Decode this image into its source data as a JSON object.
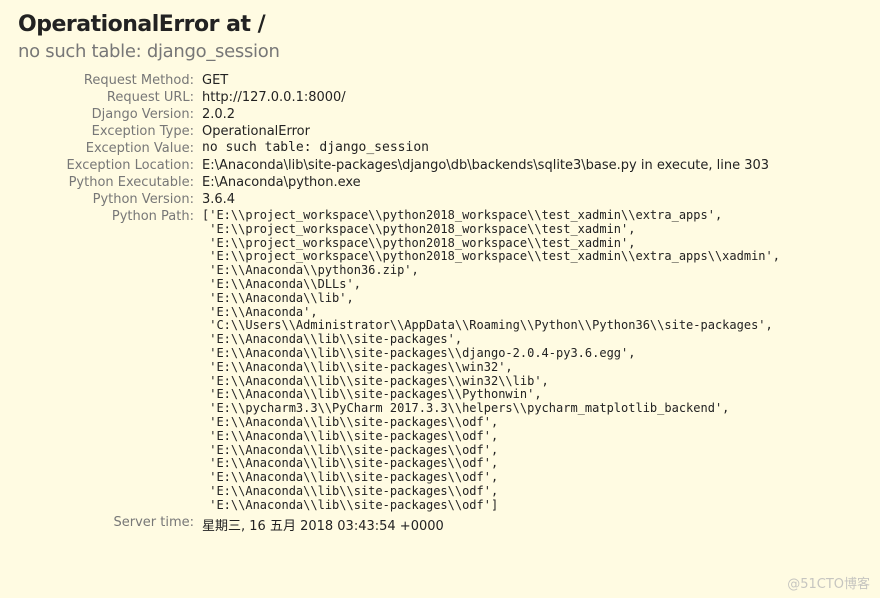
{
  "title": "OperationalError at /",
  "subtitle": "no such table: django_session",
  "labels": {
    "request_method": "Request Method:",
    "request_url": "Request URL:",
    "django_version": "Django Version:",
    "exception_type": "Exception Type:",
    "exception_value": "Exception Value:",
    "exception_location": "Exception Location:",
    "python_executable": "Python Executable:",
    "python_version": "Python Version:",
    "python_path": "Python Path:",
    "server_time": "Server time:"
  },
  "values": {
    "request_method": "GET",
    "request_url": "http://127.0.0.1:8000/",
    "django_version": "2.0.2",
    "exception_type": "OperationalError",
    "exception_value": "no such table: django_session",
    "exception_location": "E:\\Anaconda\\lib\\site-packages\\django\\db\\backends\\sqlite3\\base.py in execute, line 303",
    "python_executable": "E:\\Anaconda\\python.exe",
    "python_version": "3.6.4",
    "python_path": "['E:\\\\project_workspace\\\\python2018_workspace\\\\test_xadmin\\\\extra_apps',\n 'E:\\\\project_workspace\\\\python2018_workspace\\\\test_xadmin',\n 'E:\\\\project_workspace\\\\python2018_workspace\\\\test_xadmin',\n 'E:\\\\project_workspace\\\\python2018_workspace\\\\test_xadmin\\\\extra_apps\\\\xadmin',\n 'E:\\\\Anaconda\\\\python36.zip',\n 'E:\\\\Anaconda\\\\DLLs',\n 'E:\\\\Anaconda\\\\lib',\n 'E:\\\\Anaconda',\n 'C:\\\\Users\\\\Administrator\\\\AppData\\\\Roaming\\\\Python\\\\Python36\\\\site-packages',\n 'E:\\\\Anaconda\\\\lib\\\\site-packages',\n 'E:\\\\Anaconda\\\\lib\\\\site-packages\\\\django-2.0.4-py3.6.egg',\n 'E:\\\\Anaconda\\\\lib\\\\site-packages\\\\win32',\n 'E:\\\\Anaconda\\\\lib\\\\site-packages\\\\win32\\\\lib',\n 'E:\\\\Anaconda\\\\lib\\\\site-packages\\\\Pythonwin',\n 'E:\\\\pycharm3.3\\\\PyCharm 2017.3.3\\\\helpers\\\\pycharm_matplotlib_backend',\n 'E:\\\\Anaconda\\\\lib\\\\site-packages\\\\odf',\n 'E:\\\\Anaconda\\\\lib\\\\site-packages\\\\odf',\n 'E:\\\\Anaconda\\\\lib\\\\site-packages\\\\odf',\n 'E:\\\\Anaconda\\\\lib\\\\site-packages\\\\odf',\n 'E:\\\\Anaconda\\\\lib\\\\site-packages\\\\odf',\n 'E:\\\\Anaconda\\\\lib\\\\site-packages\\\\odf',\n 'E:\\\\Anaconda\\\\lib\\\\site-packages\\\\odf']",
    "server_time": "星期三, 16 五月 2018 03:43:54 +0000"
  },
  "watermark": "@51CTO博客"
}
